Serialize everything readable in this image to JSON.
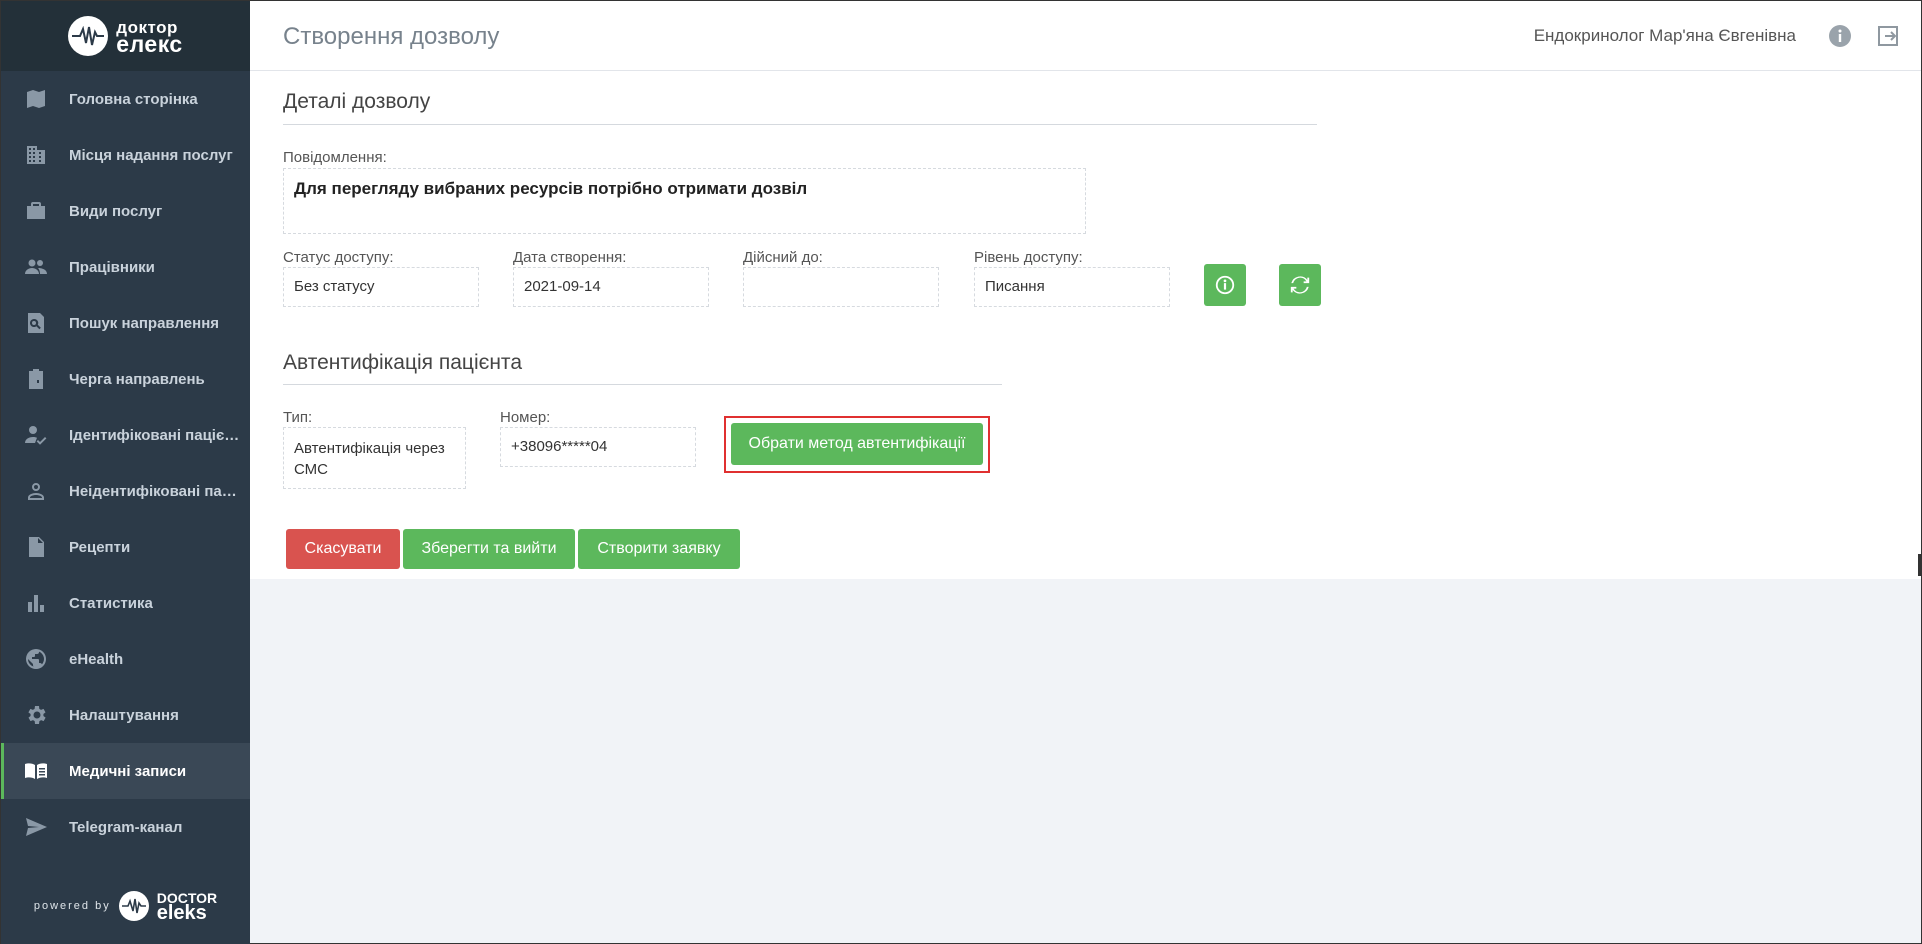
{
  "brand": {
    "line1": "доктор",
    "line2": "елекс"
  },
  "sidebar": {
    "items": [
      {
        "label": "Головна сторінка",
        "icon": "map-icon"
      },
      {
        "label": "Місця надання послуг",
        "icon": "building-icon"
      },
      {
        "label": "Види послуг",
        "icon": "briefcase-icon"
      },
      {
        "label": "Працівники",
        "icon": "people-icon"
      },
      {
        "label": "Пошук направлення",
        "icon": "search-document-icon"
      },
      {
        "label": "Черга направлень",
        "icon": "clipboard-icon"
      },
      {
        "label": "Ідентифіковані пацієнти",
        "icon": "person-check-icon"
      },
      {
        "label": "Неідентифіковані пацієнти",
        "icon": "person-outline-icon"
      },
      {
        "label": "Рецепти",
        "icon": "document-icon"
      },
      {
        "label": "Статистика",
        "icon": "bar-chart-icon"
      },
      {
        "label": "eHealth",
        "icon": "globe-icon"
      },
      {
        "label": "Налаштування",
        "icon": "gear-icon"
      },
      {
        "label": "Медичні записи",
        "icon": "book-icon",
        "active": true
      },
      {
        "label": "Telegram-канал",
        "icon": "send-icon"
      }
    ],
    "powered_by": "powered by",
    "powered_line1": "DOCTOR",
    "powered_line2": "eleks"
  },
  "header": {
    "title": "Створення дозволу",
    "user": "Ендокринолог Мар'яна Євгенівна"
  },
  "details": {
    "section_title": "Деталі дозволу",
    "message_label": "Повідомлення:",
    "message": "Для перегляду вибраних ресурсів потрібно отримати дозвіл",
    "status_label": "Статус доступу:",
    "status": "Без статусу",
    "created_label": "Дата створення:",
    "created": "2021-09-14",
    "valid_label": "Дійсний до:",
    "valid": "",
    "level_label": "Рівень доступу:",
    "level": "Писання"
  },
  "auth": {
    "section_title": "Автентифікація пацієнта",
    "type_label": "Тип:",
    "type": "Автентифікація через СМС",
    "number_label": "Номер:",
    "number": "+38096*****04",
    "choose_button": "Обрати метод автентифікації"
  },
  "actions": {
    "cancel": "Скасувати",
    "save_exit": "Зберегти та вийти",
    "create": "Створити заявку"
  },
  "colors": {
    "sidebar_bg": "#2c3a48",
    "accent_green": "#5cb85c",
    "danger_red": "#d9534f",
    "highlight_red": "#e03030"
  }
}
